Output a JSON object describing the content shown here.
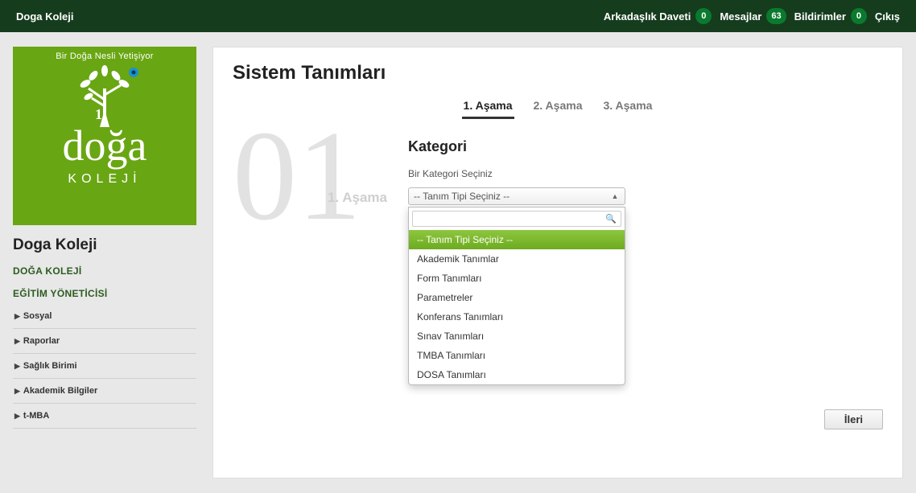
{
  "header": {
    "brand": "Doga Koleji",
    "items": [
      {
        "label": "Arkadaşlık Daveti",
        "count": "0"
      },
      {
        "label": "Mesajlar",
        "count": "63"
      },
      {
        "label": "Bildirimler",
        "count": "0"
      }
    ],
    "logout": "Çıkış"
  },
  "sidebar": {
    "logo_top": "Bir Doğa Nesli Yetişiyor",
    "logo_word": "doğa",
    "logo_sub": "KOLEJİ",
    "title": "Doga Koleji",
    "section1": "DOĞA KOLEJİ",
    "section2": "EĞİTİM YÖNETİCİSİ",
    "menu": [
      {
        "label": "Sosyal"
      },
      {
        "label": "Raporlar"
      },
      {
        "label": "Sağlık Birimi"
      },
      {
        "label": "Akademik Bilgiler"
      },
      {
        "label": "t-MBA"
      }
    ]
  },
  "main": {
    "page_title": "Sistem Tanımları",
    "steps": [
      {
        "label": "1. Aşama",
        "active": true
      },
      {
        "label": "2. Aşama",
        "active": false
      },
      {
        "label": "3. Aşama",
        "active": false
      }
    ],
    "big_number": "01",
    "stage_label": "1. Aşama",
    "section_heading": "Kategori",
    "helper_text": "Bir Kategori Seçiniz",
    "select_value": "-- Tanım Tipi Seçiniz --",
    "dropdown_options": [
      "-- Tanım Tipi Seçiniz --",
      "Akademik Tanımlar",
      "Form Tanımları",
      "Parametreler",
      "Konferans Tanımları",
      "Sınav Tanımları",
      "TMBA Tanımları",
      "DOSA Tanımları"
    ],
    "search_value": "",
    "next_button": "İleri"
  }
}
